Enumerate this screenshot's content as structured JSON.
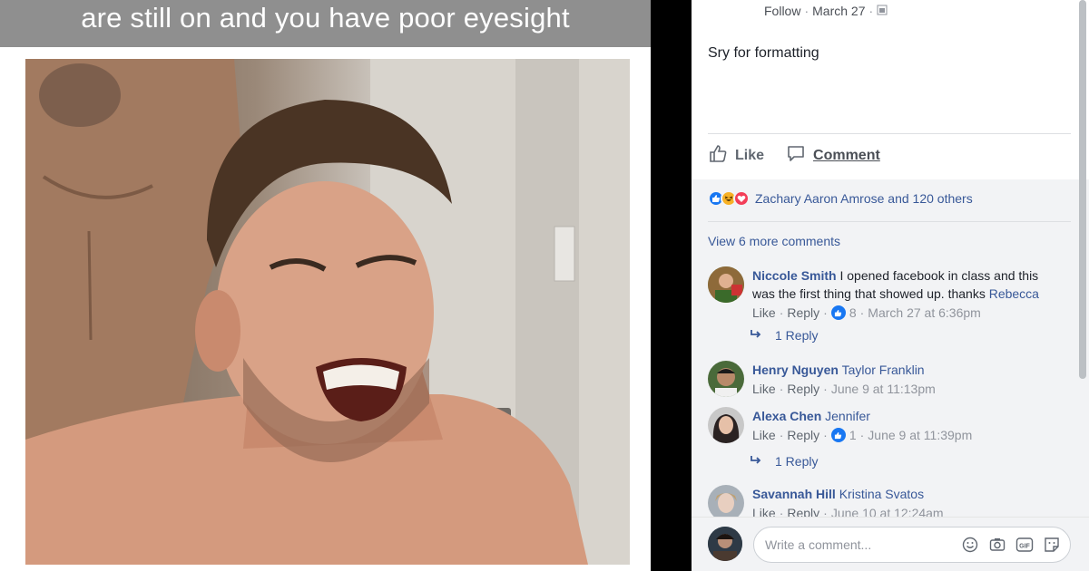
{
  "post": {
    "caption_visible": "are still on and you have poor eyesight",
    "follow_label": "Follow",
    "date": "March 27",
    "text": "Sry for formatting"
  },
  "actions": {
    "like": "Like",
    "comment": "Comment"
  },
  "reactions": {
    "summary": "Zachary Aaron Amrose and 120 others",
    "icons": [
      "like-icon",
      "haha-icon",
      "love-icon"
    ]
  },
  "comments_section": {
    "view_more": "View 6 more comments",
    "comments": [
      {
        "name": "Niccole Smith",
        "text": "I opened facebook in class and this was the first thing that showed up. thanks ",
        "tag": "Rebecca",
        "like": "Like",
        "reply": "Reply",
        "likes": "8",
        "time": "March 27 at 6:36pm",
        "replies": "1 Reply"
      },
      {
        "name": "Henry Nguyen",
        "text": "",
        "tag": "Taylor Franklin",
        "like": "Like",
        "reply": "Reply",
        "likes": "",
        "time": "June 9 at 11:13pm",
        "replies": ""
      },
      {
        "name": "Alexa Chen",
        "text": "",
        "tag": "Jennifer",
        "like": "Like",
        "reply": "Reply",
        "likes": "1",
        "time": "June 9 at 11:39pm",
        "replies": "1 Reply"
      },
      {
        "name": "Savannah Hill",
        "text": "",
        "tag": "Kristina Svatos",
        "like": "Like",
        "reply": "Reply",
        "likes": "",
        "time": "June 10 at 12:24am",
        "replies": ""
      }
    ]
  },
  "composer": {
    "placeholder": "Write a comment...",
    "icons": [
      "emoji-icon",
      "camera-icon",
      "gif-icon",
      "sticker-icon"
    ]
  },
  "colors": {
    "link": "#385898",
    "muted": "#90949c",
    "like_blue": "#1877f2",
    "love_red": "#f33e58",
    "haha_yellow": "#f7b125"
  }
}
